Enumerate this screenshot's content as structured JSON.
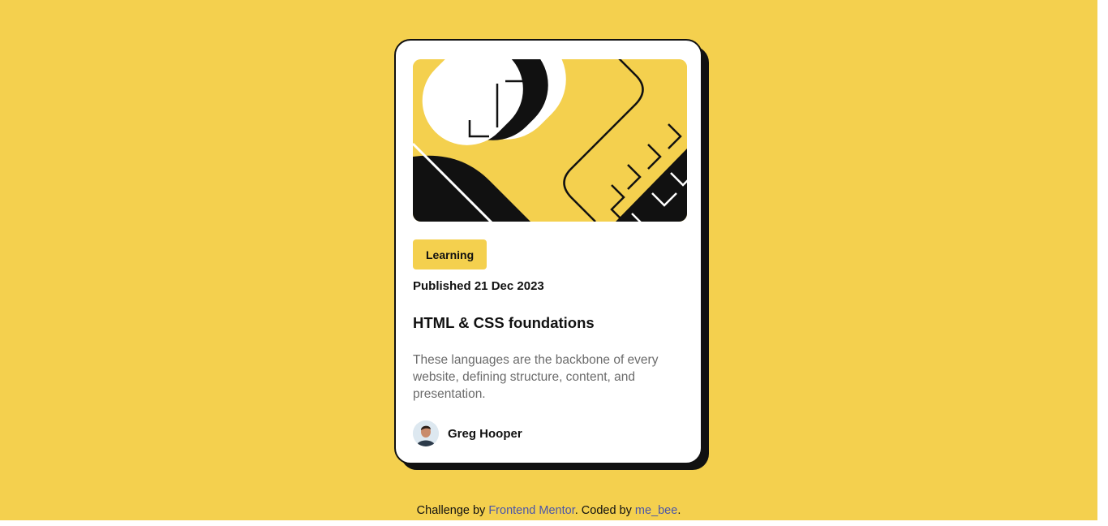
{
  "card": {
    "category_tag": "Learning",
    "published": "Published 21 Dec 2023",
    "title": "HTML & CSS foundations",
    "description": "These languages are the backbone of every website, defining structure, content, and presentation.",
    "author_name": "Greg Hooper"
  },
  "footer": {
    "prefix": "Challenge by ",
    "link1_label": "Frontend Mentor",
    "middle": ". Coded by ",
    "link2_label": "me_bee",
    "suffix": "."
  },
  "colors": {
    "background": "#f4d04e",
    "card": "#ffffff",
    "ink": "#111111",
    "muted_text": "#6b6b6b",
    "link": "#4a55a9"
  },
  "icons": {
    "hero_illustration": "abstract-illustration",
    "avatar": "user-avatar-photo"
  }
}
